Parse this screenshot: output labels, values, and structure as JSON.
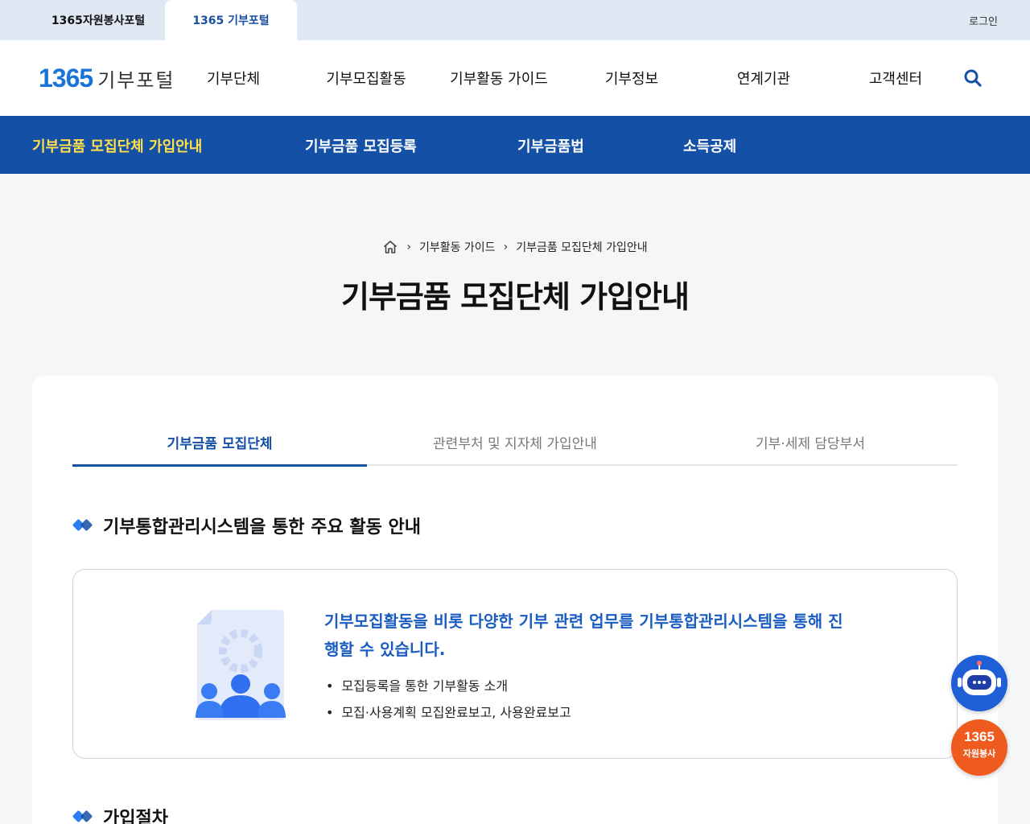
{
  "topbar": {
    "site_tabs": [
      "1365자원봉사포털",
      "1365 기부포털"
    ],
    "login": "로그인"
  },
  "header": {
    "logo_number": "1365",
    "logo_text": "기부포털",
    "menu": [
      "기부단체",
      "기부모집활동",
      "기부활동 가이드",
      "기부정보",
      "연계기관",
      "고객센터"
    ],
    "search_icon": "search-icon"
  },
  "subnav": {
    "items": [
      "기부금품 모집단체 가입안내",
      "기부금품 모집등록",
      "기부금품법",
      "소득공제"
    ],
    "active_index": 0
  },
  "breadcrumb": {
    "home_icon": "home-icon",
    "items": [
      "기부활동 가이드",
      "기부금품 모집단체 가입안내"
    ]
  },
  "page_title": "기부금품 모집단체 가입안내",
  "tabs": {
    "items": [
      "기부금품 모집단체",
      "관련부처 및 지자체 가입안내",
      "기부·세제 담당부서"
    ],
    "active_index": 0
  },
  "section1": {
    "title": "기부통합관리시스템을 통한 주요 활동 안내",
    "headline": "기부모집활동을 비롯 다양한 기부 관련 업무를 기부통합관리시스템을 통해 진행할 수 있습니다.",
    "bullets": [
      "모집등록을 통한 기부활동 소개",
      "모집·사용계획 모집완료보고, 사용완료보고"
    ]
  },
  "section2": {
    "title": "가입절차"
  },
  "floating": {
    "chatbot_icon": "chatbot-icon",
    "volunteer_number": "1365",
    "volunteer_label": "자원봉사"
  },
  "colors": {
    "primary": "#1450a6",
    "accent_yellow": "#ffe04a",
    "headline_blue": "#1a5cc0",
    "volunteer_orange": "#ef5a1e"
  }
}
